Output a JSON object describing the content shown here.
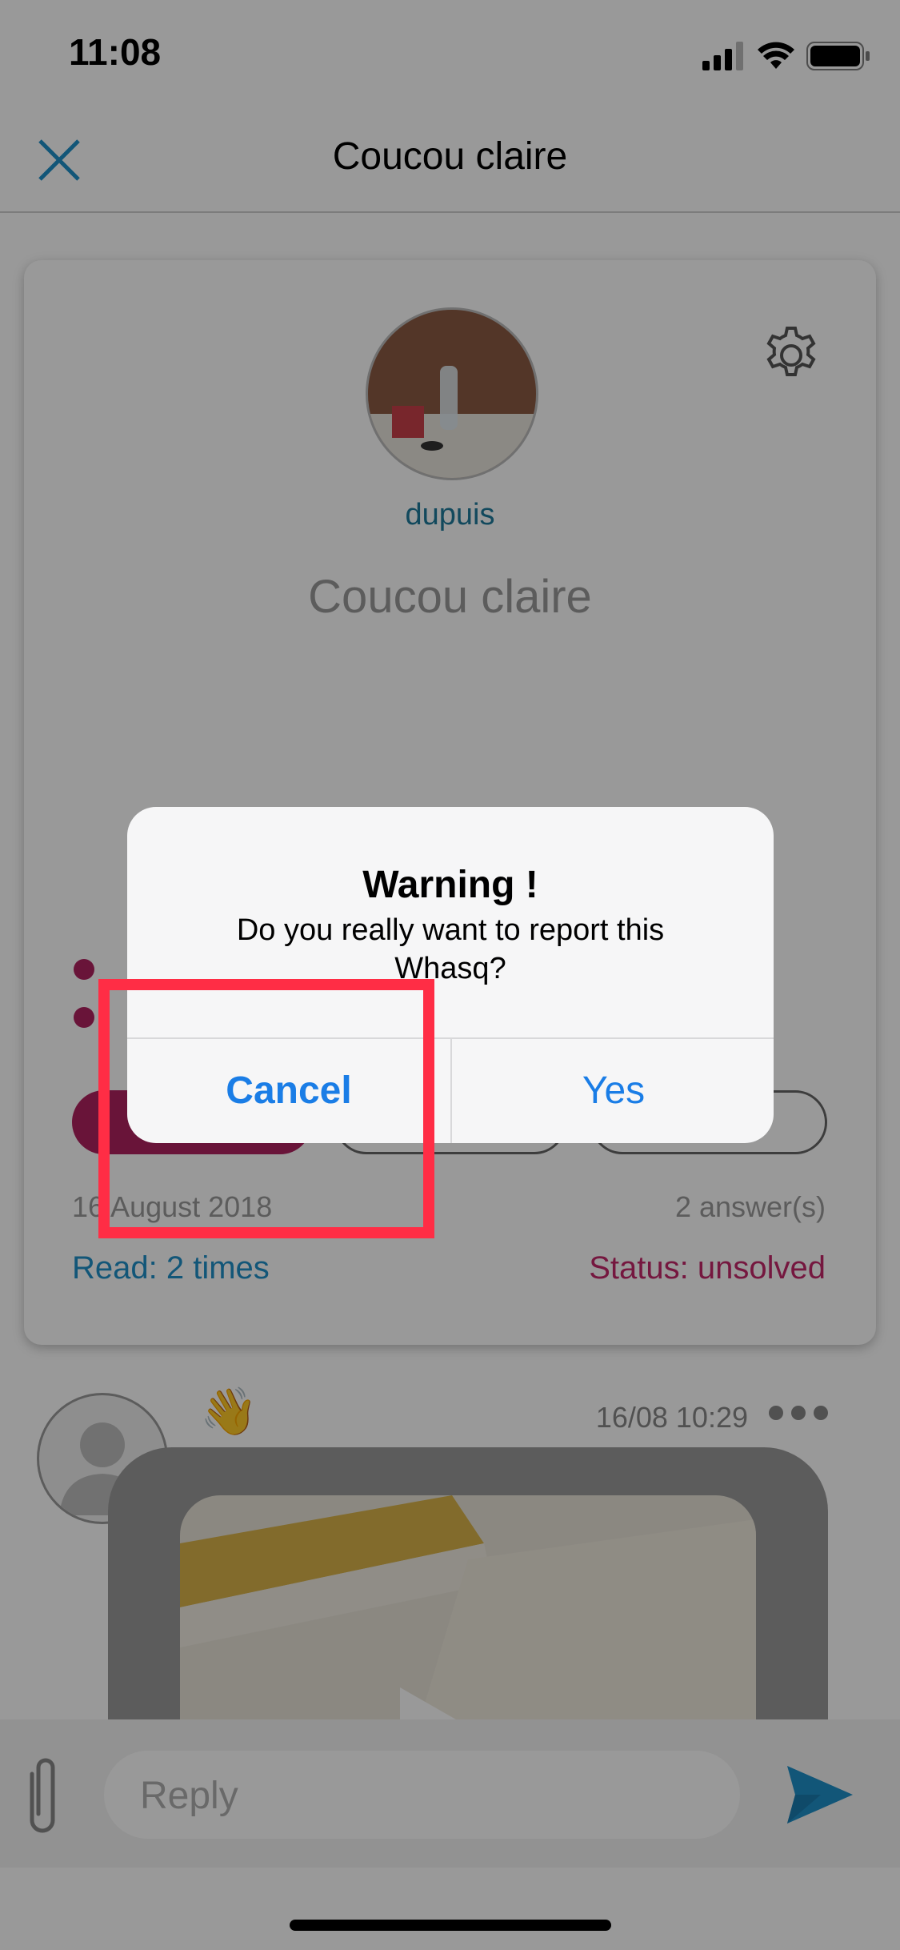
{
  "status_bar": {
    "time": "11:08"
  },
  "nav": {
    "title": "Coucou claire"
  },
  "card": {
    "username": "dupuis",
    "title": "Coucou claire",
    "date": "16 August 2018",
    "answers": "2 answer(s)",
    "read": "Read: 2 times",
    "status": "Status: unsolved"
  },
  "message": {
    "time": "16/08 10:29",
    "emoji": "👋"
  },
  "reply": {
    "placeholder": "Reply"
  },
  "alert": {
    "title": "Warning !",
    "message": "Do you really want to report this Whasq?",
    "cancel_label": "Cancel",
    "yes_label": "Yes"
  },
  "colors": {
    "accent": "#1a7de6",
    "highlight": "#ff2d45",
    "status": "#c4276a",
    "link": "#1f8fc8"
  }
}
